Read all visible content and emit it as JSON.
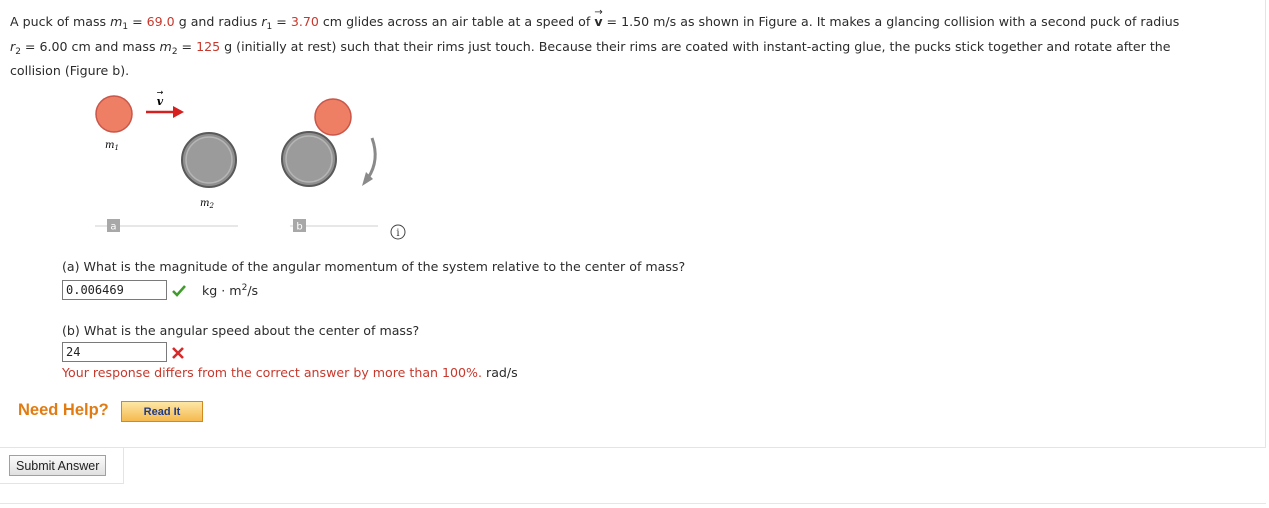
{
  "problem": {
    "t1": "A puck of mass ",
    "m1_sym": "m",
    "m1_sub": "1",
    "t2": " = ",
    "m1_val": "69.0",
    "t3": " g and radius ",
    "r1_sym": "r",
    "r1_sub": "1",
    "t4": " = ",
    "r1_val": "3.70",
    "t5": " cm glides across an air table at a speed of ",
    "v_sym": "v",
    "v_arrow": "→",
    "t6": " = 1.50 m/s as shown in Figure a. It makes a glancing collision with a second puck of radius",
    "r2_sym": "r",
    "r2_sub": "2",
    "t7": " = 6.00 cm and mass ",
    "m2_sym": "m",
    "m2_sub": "2",
    "t8": " = ",
    "m2_val": "125",
    "t9": " g (initially at rest) such that their rims just touch. Because their rims are coated with instant-acting glue, the pucks stick together and rotate after the",
    "t10": "collision (Figure b)."
  },
  "figure": {
    "label_m1": "m",
    "label_m1_sub": "1",
    "label_m2": "m",
    "label_m2_sub": "2",
    "label_v": "v",
    "tag_a": "a",
    "tag_b": "b",
    "info_glyph": "i",
    "colors": {
      "puck_small": "#ee7e64",
      "puck_small_stroke": "#c9564a",
      "puck_large": "#8f8f8f",
      "puck_large_stroke": "#595959",
      "velocity_arrow": "#d62020",
      "rotation_arrow": "#8a8a8a",
      "tag_bg": "#a8a8a8"
    }
  },
  "part_a": {
    "question": "(a) What is the magnitude of the angular momentum of the system relative to the center of mass?",
    "answer": "0.006469",
    "status": "correct",
    "unit_main": "kg · m",
    "unit_sup": "2",
    "unit_tail": "/s"
  },
  "part_b": {
    "question": "(b) What is the angular speed about the center of mass?",
    "answer": "24",
    "status": "incorrect",
    "feedback": "Your response differs from the correct answer by more than 100%.",
    "unit": " rad/s"
  },
  "help": {
    "need_help": "Need Help?",
    "read_it": "Read It"
  },
  "submit": {
    "label": "Submit Answer"
  },
  "colors": {
    "highlight_red": "#c8382c",
    "check_green": "#3f9b2c",
    "cross_red": "#d62b2b",
    "help_orange": "#e27b11"
  }
}
